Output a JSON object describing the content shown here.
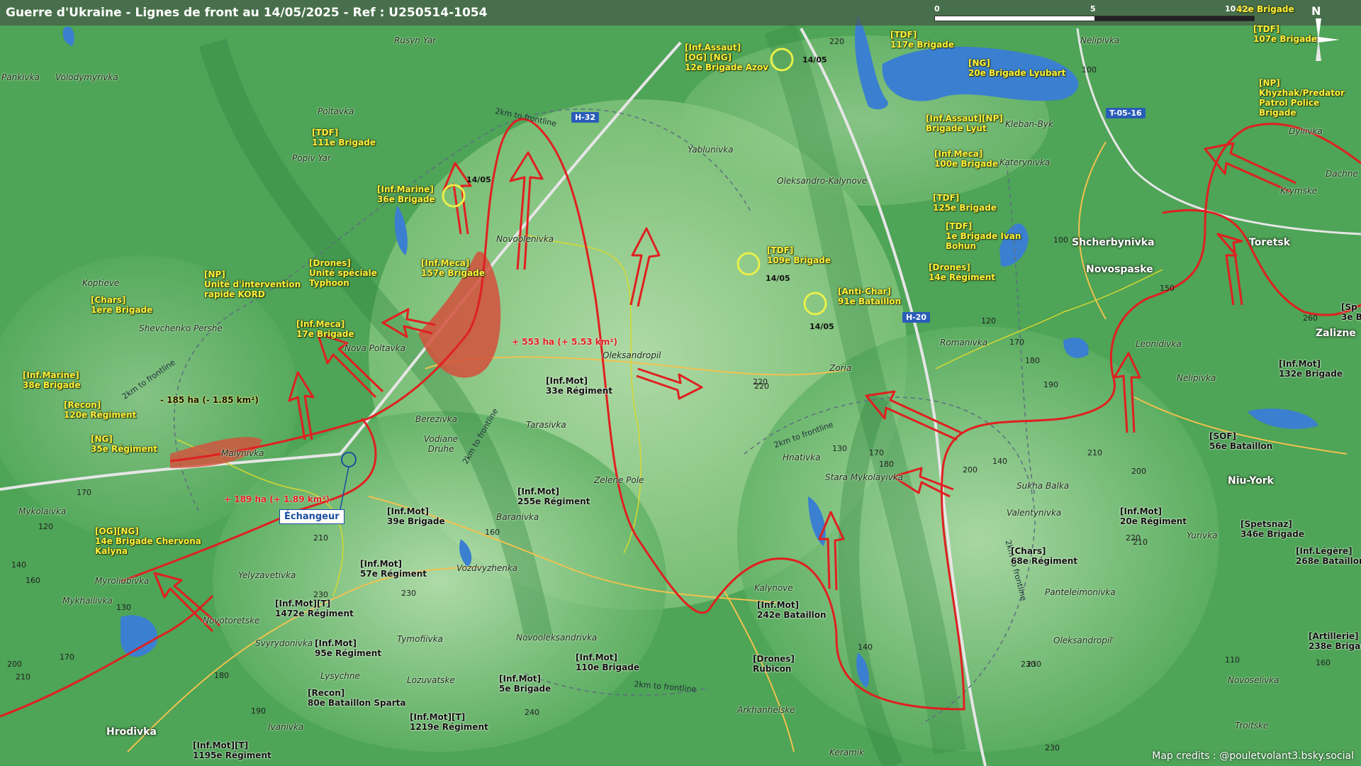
{
  "title": "Guerre d'Ukraine - Lignes de front au 14/05/2025 - Ref : U250514-1054",
  "scale": {
    "ticks": [
      "0",
      "5",
      "10 km"
    ]
  },
  "north": "N",
  "credit": "Map credits : @pouletvolant3.bsky.social",
  "gains": {
    "g1": "+ 553 ha (+ 5.53 km²)",
    "g2": "+ 189 ha (+ 1.89 km²)",
    "loss": "- 185 ha (- 1.85 km²)"
  },
  "echangeur": "Échangeur",
  "frontline": "2km to frontline",
  "roads": [
    "H-32",
    "T-05-16",
    "H-20"
  ],
  "dates": [
    "14/05",
    "14/05",
    "14/05",
    "14/05"
  ],
  "towns": [
    "Rusyn Yar",
    "Pankivka",
    "Volodymyrivka",
    "Poltavka",
    "Popiv Yar",
    "Novoolenivka",
    "Yablunivka",
    "Oleksandro-Kalynove",
    "Koptieve",
    "Shevchenko Pershe",
    "Nova Poltavka",
    "Oleksandropil",
    "Zoria",
    "Berezivka",
    "Tarasivka",
    "Vodiane Druhe",
    "Malynivka",
    "Zelene Pole",
    "Hnativka",
    "Stara Mykolayivka",
    "Sukha Balka",
    "Mykolaivka",
    "Baranivka",
    "Vozdvyzhenka",
    "Yelyzavetivka",
    "Myroliubivka",
    "Mykhailivka",
    "Novotoretske",
    "Svyrydonivka",
    "Tymofiivka",
    "Lysychne",
    "Lozuvatske",
    "Novooleksandrivka",
    "Kalynove",
    "Arkhanhelske",
    "Keramik",
    "Ivanivka",
    "Romanivka",
    "Leonidivka",
    "Nelipivka",
    "Kleban-Byk",
    "Katerynivka",
    "Dyliivka",
    "Krymske",
    "Dachne",
    "Valentynivka",
    "Panteleimonivka",
    "Oleksandropil'",
    "Yurivka",
    "Novoselivka",
    "Troitske",
    "Nelipivka"
  ],
  "big_towns": [
    "Shcherbynivka",
    "Novospaske",
    "Toretsk",
    "Zalizne",
    "Niu-York",
    "Hrodivka"
  ],
  "altitudes": [
    "220",
    "100",
    "100",
    "120",
    "150",
    "170",
    "180",
    "190",
    "260",
    "220",
    "130",
    "170",
    "180",
    "200",
    "140",
    "210",
    "200",
    "170",
    "120",
    "140",
    "160",
    "130",
    "210",
    "160",
    "230",
    "140",
    "230",
    "240",
    "190",
    "180",
    "170",
    "200",
    "210",
    "220",
    "220",
    "230",
    "210",
    "230",
    "160",
    "110",
    "230"
  ],
  "units_ua": [
    "[Inf.Assaut]\n[OG] [NG]\n12e Brigade Azov",
    "[TDF]\n117e Brigade",
    "[NG]\n20e Brigade Lyubart",
    "[TDF]\n107e Brigade",
    "[NP]\nKhyzhak/Predator\nPatrol Police\nBrigade",
    "[Inf.Assaut][NP]\nBrigade Lyut",
    "[Inf.Meca]\n100e Brigade",
    "[TDF]\n125e Brigade",
    "[TDF]\n1e Brigade Ivan\nBohun",
    "[Drones]\n14e Régiment",
    "[TDF]\n109e Brigade",
    "[Anti-Char]\n91e Bataillon",
    "[TDF]\n111e Brigade",
    "[Inf.Marine]\n36e Brigade",
    "[Inf.Meca]\n157e Brigade",
    "[NP]\nUnité d'intervention\nrapide KORD",
    "[Drones]\nUnité spéciale\nTyphoon",
    "[Chars]\n1ère Brigade",
    "[Inf.Meca]\n17e Brigade",
    "[Inf.Marine]\n38e Brigade",
    "[Recon]\n120e Régiment",
    "[NG]\n35e Régiment",
    "[OG][NG]\n14e Brigade Chervona\nKalyna",
    "42e Brigade"
  ],
  "units_ru": [
    "[Inf.Mot]\n33e Régiment",
    "[Inf.Mot]\n255e Régiment",
    "[Inf.Mot]\n39e Brigade",
    "[Inf.Mot]\n57e Régiment",
    "[Inf.Mot][T]\n1472e Régiment",
    "[Inf.Mot]\n95e Régiment",
    "[Recon]\n80e Bataillon Sparta",
    "[Inf.Mot][T]\n1219e Régiment",
    "[Inf.Mot]\n5e Brigade",
    "[Inf.Mot]\n110e Brigade",
    "[Inf.Mot]\n242e Bataillon",
    "[Drones]\nRubicon",
    "[Inf.Mot][T]\n1195e Régiment",
    "[Chars]\n68e Régiment",
    "[Inf.Mot]\n20e Régiment",
    "[Spetsnaz]\n346e Brigade",
    "[Inf.Légère]\n268e Bataillon",
    "[Artillerie]\n238e Brigade",
    "[SOF]\n56e Bataillon",
    "[Inf.Mot]\n132e Brigade",
    "[Sp\n3e B"
  ],
  "colors": {
    "ua_unit": "#fff03a",
    "front": "#e02020",
    "water": "#3b7fd0",
    "terrain_light": "#b9dfb0",
    "terrain_dark": "#2f8f45",
    "road": "#f2c14e"
  }
}
